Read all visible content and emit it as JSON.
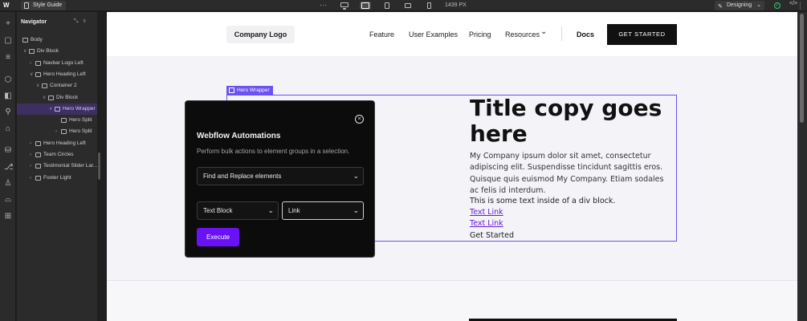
{
  "topbar": {
    "app_logo": "W",
    "page_name": "Style Guide",
    "more": "···",
    "width": "1439 PX",
    "mode": "Designing",
    "code_icon": "</>"
  },
  "navigator": {
    "title": "Navigator",
    "items": [
      {
        "label": "Body",
        "indent": 0,
        "caret": ""
      },
      {
        "label": "Div Block",
        "indent": 1,
        "caret": "∨"
      },
      {
        "label": "Navbar Logo Left",
        "indent": 2,
        "caret": "›"
      },
      {
        "label": "Hero Heading Left",
        "indent": 2,
        "caret": "∨"
      },
      {
        "label": "Container 2",
        "indent": 3,
        "caret": "∨"
      },
      {
        "label": "Div Block",
        "indent": 4,
        "caret": "∨"
      },
      {
        "label": "Hero Wrapper",
        "indent": 5,
        "caret": "∨"
      },
      {
        "label": "Hero Split",
        "indent": 6,
        "caret": ""
      },
      {
        "label": "Hero Split",
        "indent": 6,
        "caret": "›"
      },
      {
        "label": "Hero Heading Left",
        "indent": 2,
        "caret": "›"
      },
      {
        "label": "Team Circles",
        "indent": 2,
        "caret": "›"
      },
      {
        "label": "Testimonial Slider Lar...",
        "indent": 2,
        "caret": "›"
      },
      {
        "label": "Footer Light",
        "indent": 2,
        "caret": "›"
      }
    ]
  },
  "site": {
    "logo": "Company Logo",
    "links": [
      "Feature",
      "User Examples",
      "Pricing",
      "Resources"
    ],
    "resources_chevron": "⌄",
    "docs": "Docs",
    "cta": "GET STARTED"
  },
  "selection": {
    "tag": "Hero Wrapper"
  },
  "hero": {
    "title": "Title copy goes here",
    "paragraph": "My Company ipsum dolor sit amet, consectetur adipiscing elit. Suspendisse tincidunt sagittis eros. Quisque quis euismod My Company. Etiam sodales ac felis id interdum.",
    "div_text": "This is some text inside of a div block.",
    "link1": "Text Link",
    "link2": "Text Link",
    "get_started": "Get Started"
  },
  "modal": {
    "close": "×",
    "title": "Webflow Automations",
    "subtitle": "Perform bulk actions to element groups in a selection.",
    "action_select": "Find and Replace elements",
    "from_select": "Text Block",
    "to_select": "Link",
    "chevron": "⌄",
    "execute": "Execute"
  },
  "colors": {
    "accent": "#6c52f5",
    "execute": "#6a12f5",
    "link": "#6a1bd6"
  }
}
